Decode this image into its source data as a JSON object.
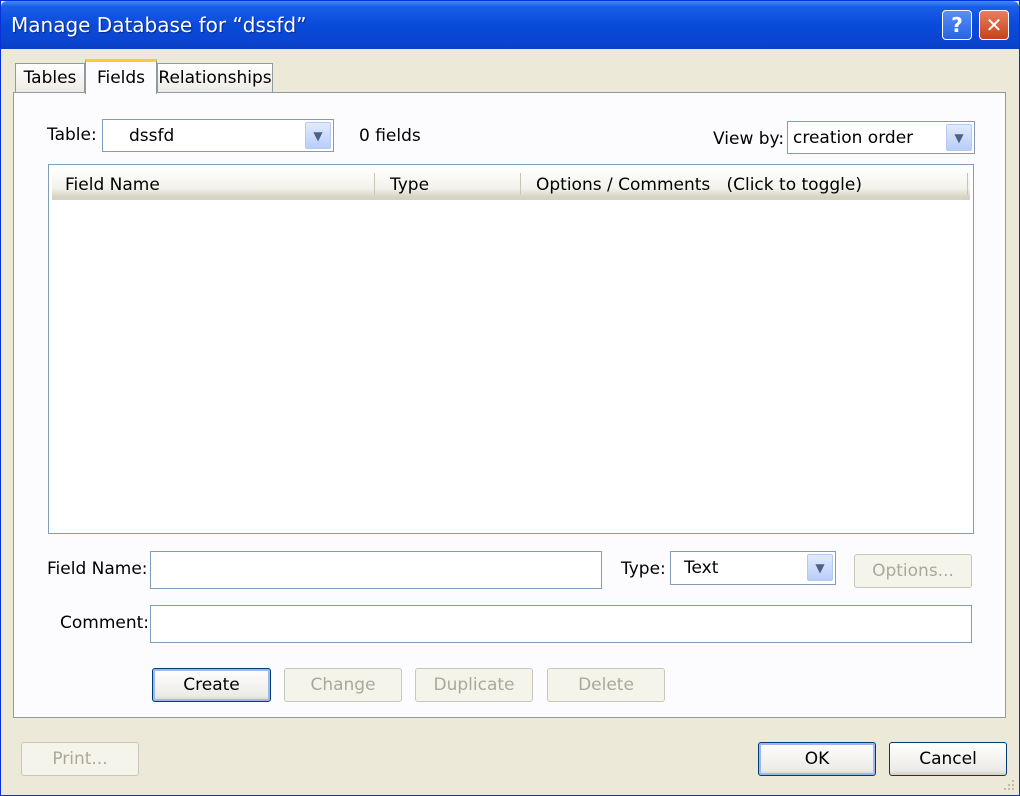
{
  "window": {
    "title": "Manage Database for “dssfd”",
    "help_glyph": "?",
    "close_glyph": "✕"
  },
  "tabs": [
    {
      "label": "Tables",
      "active": false
    },
    {
      "label": "Fields",
      "active": true
    },
    {
      "label": "Relationships",
      "active": false
    }
  ],
  "table_selector": {
    "label": "Table:",
    "value": "dssfd",
    "count_text": "0 fields"
  },
  "view_by": {
    "label": "View by:",
    "value": "creation order"
  },
  "field_list": {
    "columns": [
      "Field Name",
      "Type",
      "Options / Comments   (Click to toggle)"
    ],
    "rows": []
  },
  "form": {
    "field_name_label": "Field Name:",
    "field_name_value": "",
    "type_label": "Type:",
    "type_value": "Text",
    "options_button": "Options...",
    "comment_label": "Comment:",
    "comment_value": ""
  },
  "actions": {
    "create": "Create",
    "change": "Change",
    "duplicate": "Duplicate",
    "delete": "Delete"
  },
  "footer": {
    "print": "Print...",
    "ok": "OK",
    "cancel": "Cancel"
  },
  "colors": {
    "title_bar": "#0A4ADB",
    "dialog_bg": "#ECE9D8",
    "tab_highlight": "#FFC83C",
    "disabled_text": "#ACA899"
  }
}
